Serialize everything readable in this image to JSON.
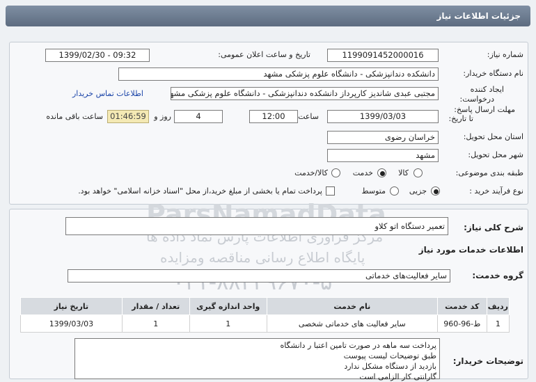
{
  "header": {
    "title": "جزئیات اطلاعات نیاز"
  },
  "need_number": {
    "label": "شماره نیاز:",
    "value": "1199091452000016"
  },
  "announce": {
    "label": "تاریخ و ساعت اعلان عمومی:",
    "value": "1399/02/30 - 09:32"
  },
  "buyer": {
    "label": "نام دستگاه خریدار:",
    "value": "دانشکده دندانپزشکی - دانشگاه علوم پزشکی مشهد"
  },
  "creator": {
    "label_line1": "ایجاد کننده",
    "label_line2": "درخواست:",
    "value": "مجتبی عبدی شاندیز کارپرداز دانشکده دندانپزشکی - دانشگاه علوم پزشکی مشهد",
    "contact_link": "اطلاعات تماس خریدار"
  },
  "deadline": {
    "label_line1": "مهلت ارسال پاسخ:",
    "label_line2": "تا تاریخ:",
    "date": "1399/03/03",
    "time_label": "ساعت",
    "time": "12:00",
    "days": "4",
    "days_label": "روز و",
    "remaining": "01:46:59",
    "remaining_label": "ساعت باقی مانده"
  },
  "province": {
    "label": "استان محل تحویل:",
    "value": "خراسان رضوی"
  },
  "city": {
    "label": "شهر محل تحویل:",
    "value": "مشهد"
  },
  "category": {
    "label": "طبقه بندی موضوعی:",
    "options": [
      "کالا",
      "خدمت",
      "کالا/خدمت"
    ],
    "selected": "خدمت"
  },
  "process": {
    "label": "نوع فرآیند خرید :",
    "options": [
      "جزیی",
      "متوسط"
    ],
    "selected": "جزیی",
    "payment_note": "پرداخت تمام یا بخشی از مبلغ خرید،از محل \"اسناد خزانه اسلامی\" خواهد بود."
  },
  "summary": {
    "label": "شرح کلی نیاز:",
    "value": "تعمیر دستگاه اتو کلاو"
  },
  "services_title": "اطلاعات خدمات مورد نیاز",
  "service_group": {
    "label": "گروه خدمت:",
    "value": "سایر فعالیت‌های خدماتی"
  },
  "table": {
    "headers": [
      "ردیف",
      "کد خدمت",
      "نام خدمت",
      "واحد اندازه گیری",
      "تعداد / مقدار",
      "تاریخ نیاز"
    ],
    "rows": [
      [
        "1",
        "ط-96-960",
        "سایر فعالیت های خدماتی شخصی",
        "1",
        "1",
        "1399/03/03"
      ]
    ]
  },
  "buyer_notes": {
    "label": "توضیحات خریدار:",
    "lines": [
      "پرداخت سه ماهه در صورت تامین اعتبا ر دانشگاه",
      "طبق توضیحات لیست پیوست",
      "بازدید از دستگاه مشکل ندارد",
      "گارانتی کار الزامی است"
    ]
  },
  "watermark": {
    "brand": "ParsNamadData",
    "line1": "مرکز فرآوری اطلاعات پارس نماد داده ها",
    "line2": "پایگاه اطلاع رسانی مناقصه ومزایده",
    "phone": "۰۲۱-۸۸۳۴۹۶۷۰-۵"
  }
}
